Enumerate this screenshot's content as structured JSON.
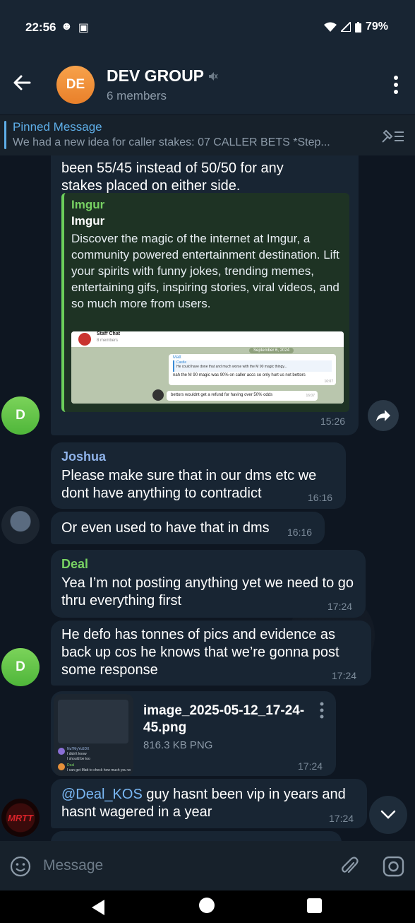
{
  "status": {
    "time": "22:56",
    "battery": "79%"
  },
  "header": {
    "avatar_initials": "DE",
    "title": "DEV GROUP",
    "subtitle": "6 members",
    "accent_color": "#f29140"
  },
  "pinned": {
    "label": "Pinned Message",
    "text": "We had a new idea for caller stakes:  07 CALLER BETS *Step..."
  },
  "messages": [
    {
      "text": "been 55/45 instead of 50/50 for any stakes placed on either side.",
      "link_site": "Imgur",
      "link_title": "Imgur",
      "link_desc": "Discover the magic of the internet at Imgur, a community powered entertainment destination. Lift your spirits with funny jokes, trending memes, entertaining gifs, inspiring stories, viral videos, and so much more from users.",
      "preview_chat_title": "Staff Chat",
      "preview_chat_members": "8 members",
      "preview_date": "September 6, 2024",
      "preview_sender": "Matt",
      "preview_quote_name": "Castle",
      "preview_quote_text": "He could have done that and much worse with the M 90 magic thingy...",
      "preview_line1": "nah the M 90 magic was 90% on caller accs so only hurt us not bettors",
      "preview_time1": "16:07",
      "preview_line2": "bettors wouldnt get a refund for having over 50% odds",
      "preview_time2": "16:07",
      "time": "15:26",
      "avatar": "D"
    },
    {
      "sender": "Joshua",
      "text": "Please make sure that in our dms etc we dont have anything to contradict",
      "time": "16:16"
    },
    {
      "text": "Or even used to have that in dms",
      "time": "16:16"
    },
    {
      "sender": "Deal",
      "text": "Yea I’m not posting anything yet we need to go thru everything first",
      "time": "17:24"
    },
    {
      "text": "He defo has tonnes of pics and evidence as back up cos he knows that we’re gonna post some response",
      "time": "17:24",
      "avatar": "D"
    },
    {
      "file_name": "image_2025-05-12_17-24-45.png",
      "file_size": "816.3 KB PNG",
      "time": "17:24"
    },
    {
      "mention": "@Deal_KOS",
      "text": " guy hasnt been vip in years and hasnt wagered in a year",
      "time": "17:24",
      "avatar": "MRTT"
    }
  ],
  "thumb": {
    "name1": "Nu?MyYu5DX",
    "line1": "I didn't know",
    "line2": "I should be too",
    "name2": "Deal",
    "line3": "I can get Matt to check how much you would"
  },
  "composer": {
    "placeholder": "Message"
  },
  "colors": {
    "name_joshua": "#8fb3ea",
    "name_deal": "#78d263",
    "mention": "#7ab8f5"
  }
}
